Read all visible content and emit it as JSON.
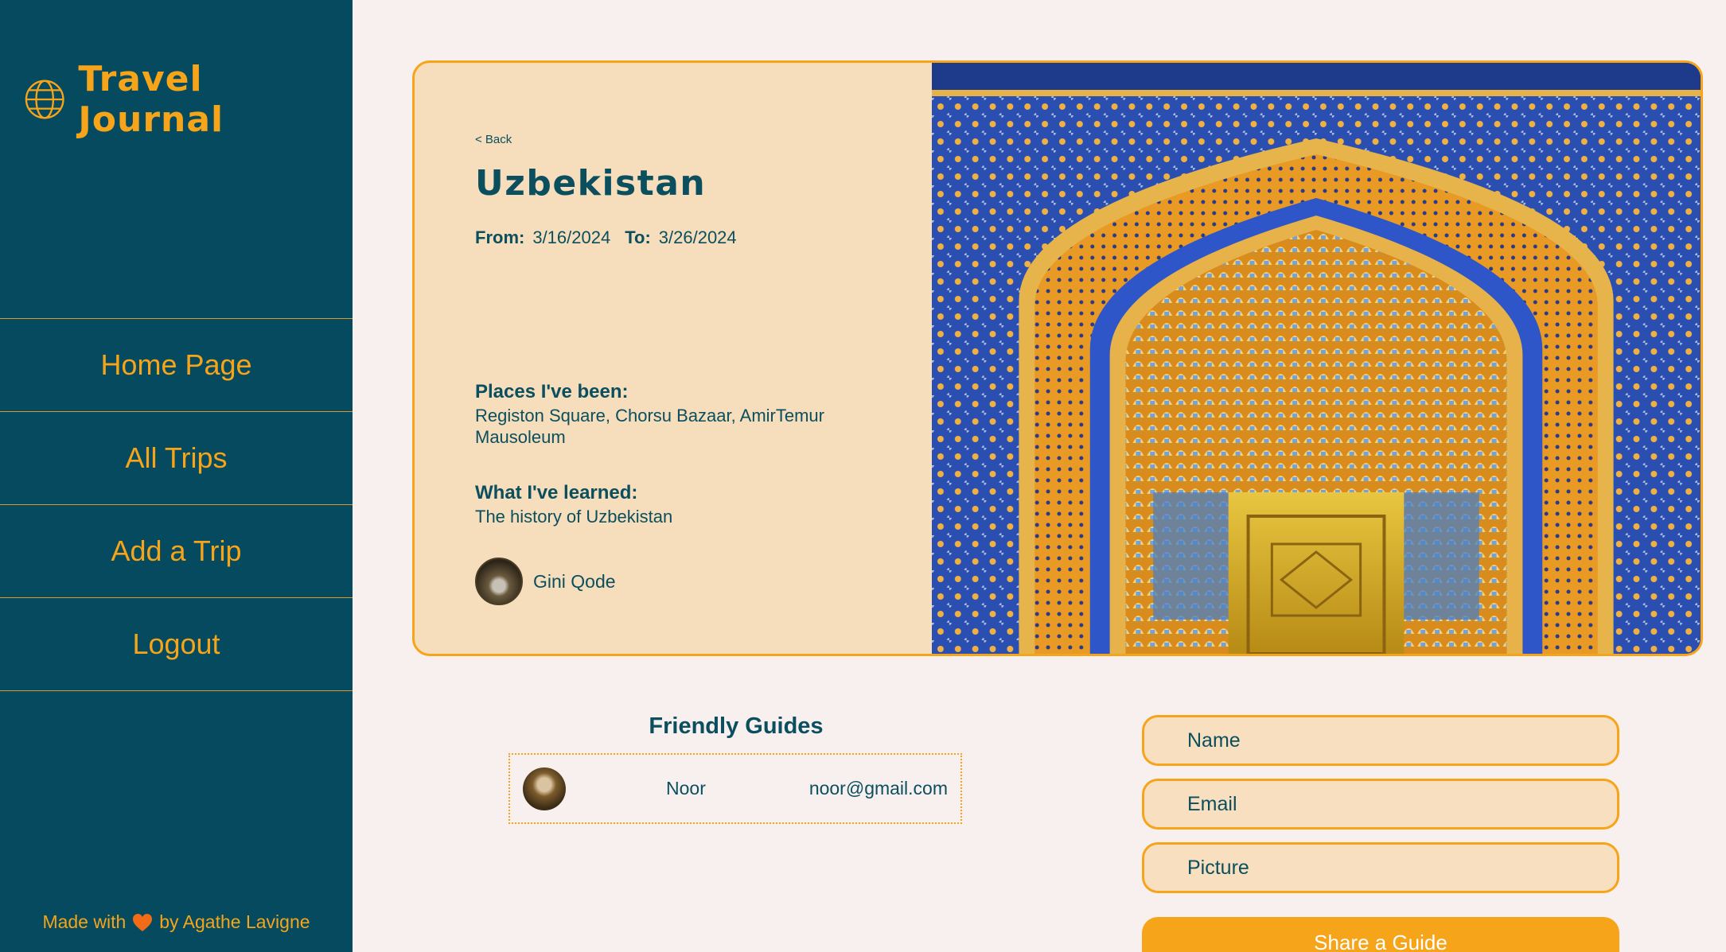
{
  "brand": {
    "title": "Travel Journal",
    "icon": "globe-icon",
    "color": "#f6a41a"
  },
  "sidebar": {
    "items": [
      {
        "label": "Home Page"
      },
      {
        "label": "All Trips"
      },
      {
        "label": "Add a Trip"
      },
      {
        "label": "Logout"
      }
    ],
    "footer": {
      "prefix": "Made with",
      "suffix": "by Agathe Lavigne",
      "icon": "heart-icon"
    }
  },
  "trip": {
    "back_label": "< Back",
    "title": "Uzbekistan",
    "from_label": "From:",
    "from_value": "3/16/2024",
    "to_label": "To:",
    "to_value": "3/26/2024",
    "places_heading": "Places I've been:",
    "places_text": "Registon Square, Chorsu Bazaar, AmirTemur Mausoleum",
    "learned_heading": "What I've learned:",
    "learned_text": "The history of Uzbekistan",
    "author_name": "Gini Qode",
    "image_alt": "Tiled mosque archway"
  },
  "guides": {
    "title": "Friendly Guides",
    "rows": [
      {
        "name": "Noor",
        "email": "noor@gmail.com"
      }
    ]
  },
  "form": {
    "name_placeholder": "Name",
    "email_placeholder": "Email",
    "picture_placeholder": "Picture",
    "submit_label": "Share a Guide"
  },
  "colors": {
    "sidebar": "#054a5e",
    "accent": "#f6a41a",
    "card": "#f6ddbb",
    "text": "#0b4f5f"
  }
}
